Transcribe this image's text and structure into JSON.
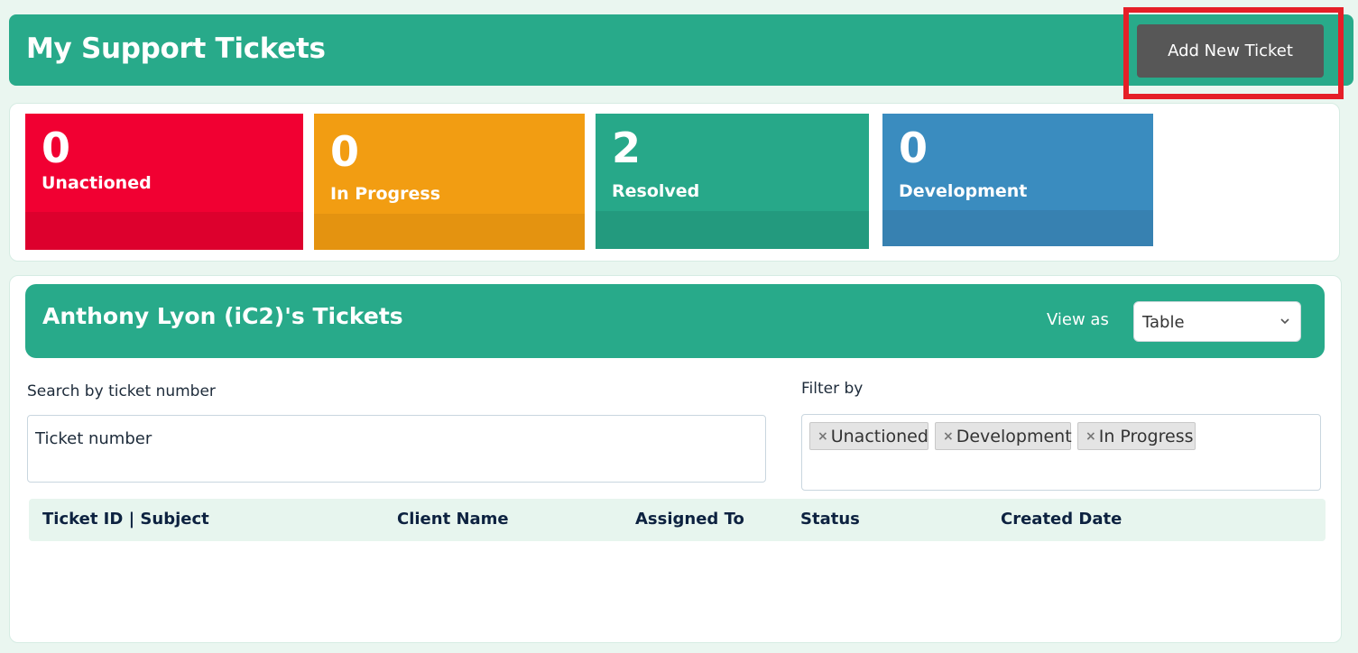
{
  "header": {
    "title": "My Support Tickets",
    "add_button_label": "Add New Ticket"
  },
  "stats": [
    {
      "count": "0",
      "label": "Unactioned",
      "color": "#f10032"
    },
    {
      "count": "0",
      "label": "In Progress",
      "color": "#f29d12"
    },
    {
      "count": "2",
      "label": "Resolved",
      "color": "#27a889"
    },
    {
      "count": "0",
      "label": "Development",
      "color": "#3a8cbf"
    }
  ],
  "tickets": {
    "title": "Anthony Lyon (iC2)'s Tickets",
    "view_label": "View as",
    "view_selected": "Table",
    "search_label": "Search by ticket number",
    "search_value": "Ticket number",
    "filter_label": "Filter by",
    "filters": [
      "Unactioned",
      "Development",
      "In Progress"
    ],
    "columns": [
      "Ticket ID | Subject",
      "Client Name",
      "Assigned To",
      "Status",
      "Created Date"
    ]
  },
  "colors": {
    "brand": "#28aa8a",
    "button": "#575757",
    "highlight": "#e51f28"
  }
}
